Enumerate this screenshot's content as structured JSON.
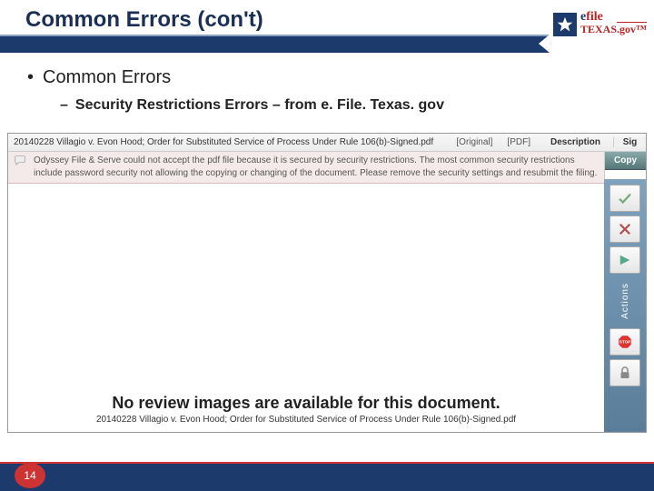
{
  "header": {
    "title": "Common Errors (con't)"
  },
  "logo": {
    "line1a": "e",
    "line1b": "file",
    "line2": "TEXAS",
    "gov": ".gov™"
  },
  "bullets": {
    "level1": "Common Errors",
    "level2": "Security Restrictions Errors – from e. File. Texas. gov"
  },
  "shot": {
    "filename": "20140228 Villagio v. Evon Hood; Order for Substituted Service of Process Under Rule 106(b)-Signed.pdf",
    "tag_original": "[Original]",
    "tag_pdf": "[PDF]",
    "description_label": "Description",
    "sig_label": "Sig",
    "error_text": "Odyssey File & Serve could not accept the pdf file because it is secured by security restrictions.  The most common security restrictions include password security not allowing the copying or changing of the document.  Please remove the security settings and resubmit the filing.",
    "copy_label": "Copy",
    "actions_label": "Actions",
    "no_review": "No review images are available for this document.",
    "no_review_sub": "20140228 Villagio v. Evon Hood; Order for Substituted Service of Process Under Rule 106(b)-Signed.pdf"
  },
  "page_number": "14"
}
